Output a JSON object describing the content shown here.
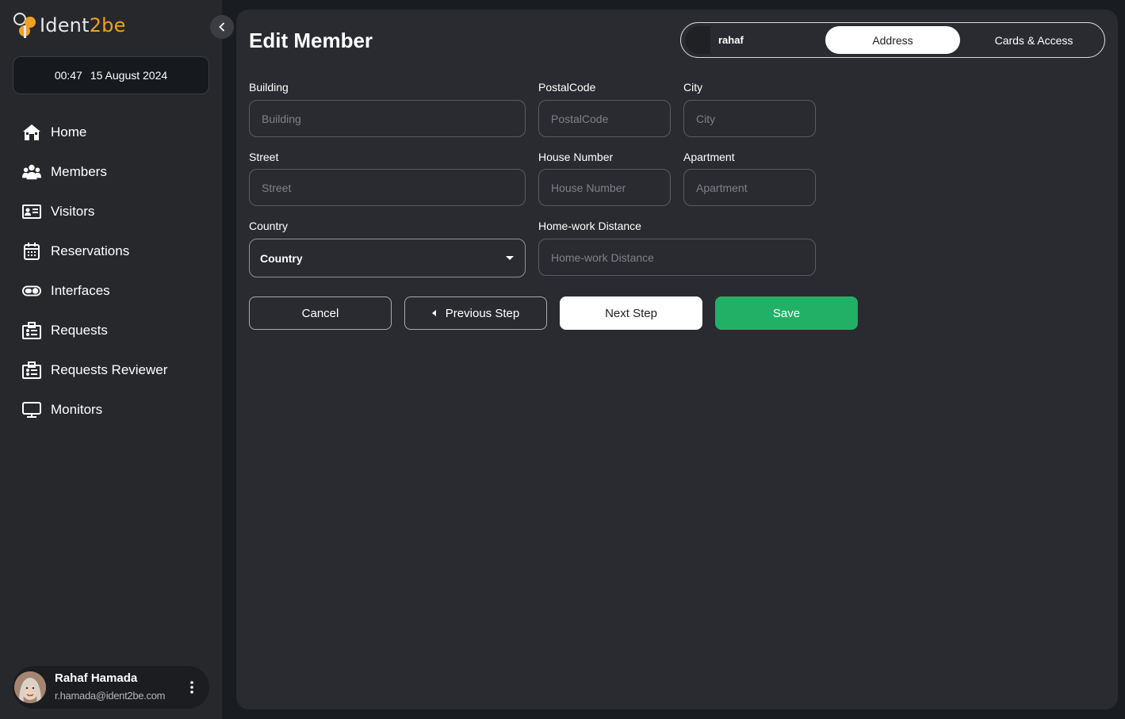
{
  "brand": {
    "name_part1": "Ident",
    "name_part2": "2be"
  },
  "datetime": {
    "time": "00:47",
    "date": "15 August 2024"
  },
  "nav": [
    {
      "label": "Home",
      "icon": "home-icon"
    },
    {
      "label": "Members",
      "icon": "members-icon"
    },
    {
      "label": "Visitors",
      "icon": "id-card-icon"
    },
    {
      "label": "Reservations",
      "icon": "calendar-icon"
    },
    {
      "label": "Interfaces",
      "icon": "toggle-icon"
    },
    {
      "label": "Requests",
      "icon": "clipboard-icon"
    },
    {
      "label": "Requests Reviewer",
      "icon": "clipboard-icon"
    },
    {
      "label": "Monitors",
      "icon": "monitor-icon"
    }
  ],
  "user": {
    "name": "Rahaf Hamada",
    "email": "r.hamada@ident2be.com"
  },
  "page": {
    "title": "Edit Member"
  },
  "steps": {
    "member": "rahaf",
    "address": "Address",
    "cards": "Cards & Access"
  },
  "form": {
    "building": {
      "label": "Building",
      "placeholder": "Building"
    },
    "postal": {
      "label": "PostalCode",
      "placeholder": "PostalCode"
    },
    "city": {
      "label": "City",
      "placeholder": "City"
    },
    "street": {
      "label": "Street",
      "placeholder": "Street"
    },
    "house": {
      "label": "House Number",
      "placeholder": "House Number"
    },
    "apartment": {
      "label": "Apartment",
      "placeholder": "Apartment"
    },
    "country": {
      "label": "Country",
      "value": "Country"
    },
    "distance": {
      "label": "Home-work Distance",
      "placeholder": "Home-work Distance"
    }
  },
  "buttons": {
    "cancel": "Cancel",
    "previous": "Previous Step",
    "next": "Next Step",
    "save": "Save"
  },
  "colors": {
    "accent_orange": "#f0a023",
    "save_green": "#22b067",
    "sidebar_bg": "#27282c",
    "panel_bg": "#2a2b30"
  }
}
